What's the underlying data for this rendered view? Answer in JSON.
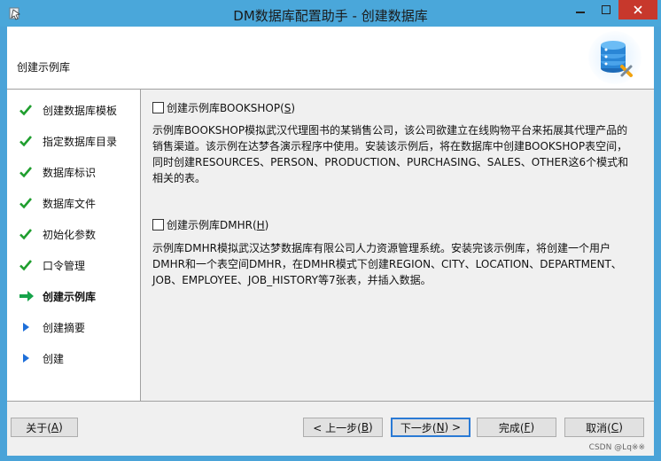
{
  "window": {
    "title": "DM数据库配置助手 - 创建数据库"
  },
  "header": {
    "title": "创建示例库"
  },
  "steps": [
    {
      "label": "创建数据库模板",
      "status": "done"
    },
    {
      "label": "指定数据库目录",
      "status": "done"
    },
    {
      "label": "数据库标识",
      "status": "done"
    },
    {
      "label": "数据库文件",
      "status": "done"
    },
    {
      "label": "初始化参数",
      "status": "done"
    },
    {
      "label": "口令管理",
      "status": "done"
    },
    {
      "label": "创建示例库",
      "status": "current"
    },
    {
      "label": "创建摘要",
      "status": "pending"
    },
    {
      "label": "创建",
      "status": "pending"
    }
  ],
  "options": {
    "bookshop": {
      "label": "创建示例库BOOKSHOP(S)",
      "label_prefix": "创建示例库BOOKSHOP(",
      "label_key": "S",
      "label_suffix": ")",
      "checked": false,
      "desc_lines": [
        "示例库BOOKSHOP模拟武汉代理图书的某销售公司，该公司欲建立在线购物平台来拓展其代理产品的",
        "销售渠道。该示例在达梦各演示程序中使用。安装该示例后，将在数据库中创建BOOKSHOP表空间，",
        "同时创建RESOURCES、PERSON、PRODUCTION、PURCHASING、SALES、OTHER这6个模式和",
        "相关的表。"
      ]
    },
    "dmhr": {
      "label": "创建示例库DMHR(H)",
      "label_prefix": "创建示例库DMHR(",
      "label_key": "H",
      "label_suffix": ")",
      "checked": false,
      "desc_lines": [
        "示例库DMHR模拟武汉达梦数据库有限公司人力资源管理系统。安装完该示例库，将创建一个用户",
        "DMHR和一个表空间DMHR，在DMHR模式下创建REGION、CITY、LOCATION、DEPARTMENT、",
        "JOB、EMPLOYEE、JOB_HISTORY等7张表，并插入数据。"
      ]
    }
  },
  "buttons": {
    "about": {
      "pre": "关于(",
      "key": "A",
      "post": ")"
    },
    "back": {
      "pre": "< 上一步(",
      "key": "B",
      "post": ")"
    },
    "next": {
      "pre": "下一步(",
      "key": "N",
      "post": ") >"
    },
    "finish": {
      "pre": "完成(",
      "key": "F",
      "post": ")"
    },
    "cancel": {
      "pre": "取消(",
      "key": "C",
      "post": ")"
    }
  },
  "watermark": "CSDN @Lq※※",
  "colors": {
    "titlebar": "#4aa7da",
    "close": "#c7382c",
    "check": "#1f9e2e",
    "current_arrow": "#16a34a",
    "pending_arrow": "#1e6fd9"
  },
  "icons": {
    "done": "check-icon",
    "current": "arrow-right-icon",
    "pending": "triangle-right-icon"
  }
}
